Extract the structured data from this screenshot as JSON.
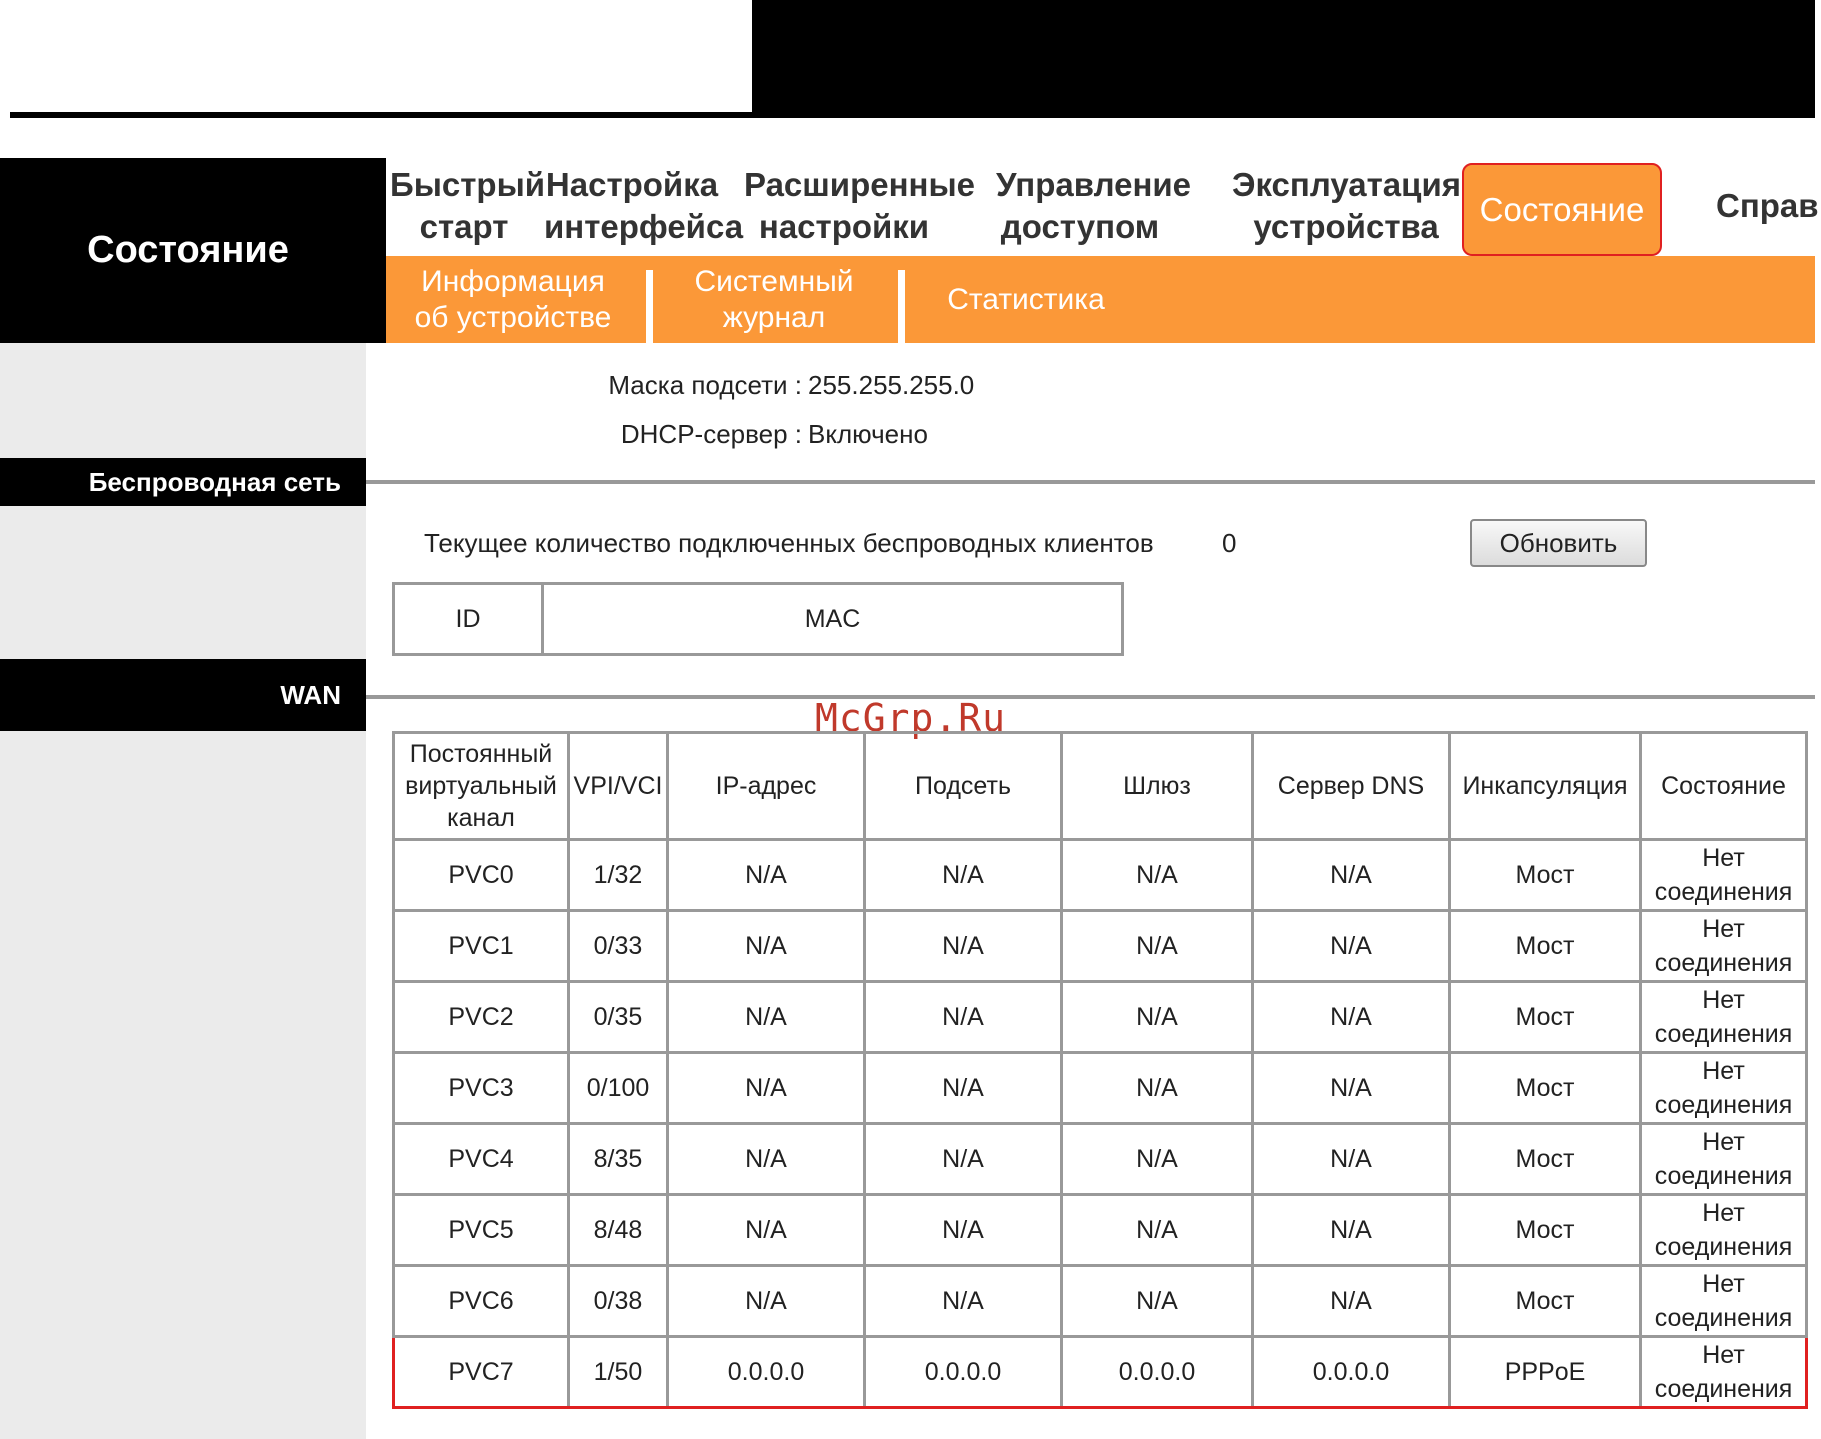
{
  "header": {
    "section_title": "Состояние"
  },
  "menu": [
    {
      "label": "Быстрый\nстарт"
    },
    {
      "label": "Настройка\nинтерфейса"
    },
    {
      "label": "Расширенные\nнастройки"
    },
    {
      "label": "Управление\nдоступом"
    },
    {
      "label": "Эксплуатация\nустройства"
    },
    {
      "label": "Состояние",
      "active": true
    },
    {
      "label": "Справ"
    }
  ],
  "submenu": [
    {
      "label": "Информация\nоб устройстве"
    },
    {
      "label": "Системный\nжурнал"
    },
    {
      "label": "Статистика"
    }
  ],
  "lan": {
    "mask_label": "Маска подсети :",
    "mask_value": "255.255.255.0",
    "dhcp_label": "DHCP-сервер :",
    "dhcp_value": "Включено"
  },
  "sidebar": {
    "wireless": "Беспроводная сеть",
    "wan": "WAN"
  },
  "wireless": {
    "clients_label": "Текущее количество подключенных беспроводных клиентов",
    "clients_count": "0",
    "refresh_label": "Обновить",
    "table_headers": [
      "ID",
      "MAC"
    ]
  },
  "watermark": "McGrp.Ru",
  "wan": {
    "headers": [
      "Постоянный\nвиртуальный\nканал",
      "VPI/VCI",
      "IP-адрес",
      "Подсеть",
      "Шлюз",
      "Сервер DNS",
      "Инкапсуляция",
      "Состояние"
    ],
    "rows": [
      [
        "PVC0",
        "1/32",
        "N/A",
        "N/A",
        "N/A",
        "N/A",
        "Мост",
        "Нет\nсоединения"
      ],
      [
        "PVC1",
        "0/33",
        "N/A",
        "N/A",
        "N/A",
        "N/A",
        "Мост",
        "Нет\nсоединения"
      ],
      [
        "PVC2",
        "0/35",
        "N/A",
        "N/A",
        "N/A",
        "N/A",
        "Мост",
        "Нет\nсоединения"
      ],
      [
        "PVC3",
        "0/100",
        "N/A",
        "N/A",
        "N/A",
        "N/A",
        "Мост",
        "Нет\nсоединения"
      ],
      [
        "PVC4",
        "8/35",
        "N/A",
        "N/A",
        "N/A",
        "N/A",
        "Мост",
        "Нет\nсоединения"
      ],
      [
        "PVC5",
        "8/48",
        "N/A",
        "N/A",
        "N/A",
        "N/A",
        "Мост",
        "Нет\nсоединения"
      ],
      [
        "PVC6",
        "0/38",
        "N/A",
        "N/A",
        "N/A",
        "N/A",
        "Мост",
        "Нет\nсоединения"
      ],
      [
        "PVC7",
        "1/50",
        "0.0.0.0",
        "0.0.0.0",
        "0.0.0.0",
        "0.0.0.0",
        "PPPoE",
        "Нет\nсоединения"
      ]
    ]
  }
}
